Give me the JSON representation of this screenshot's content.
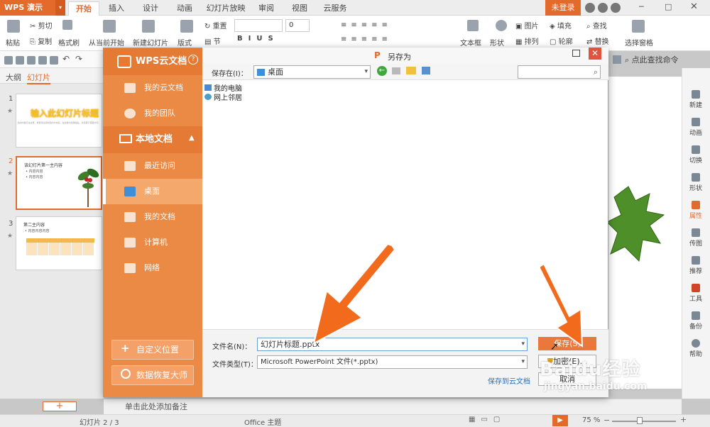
{
  "titlebar": {
    "app_name": "WPS 演示",
    "tabs": [
      "开始",
      "插入",
      "设计",
      "动画",
      "幻灯片放映",
      "审阅",
      "视图",
      "云服务"
    ],
    "active_tab": "开始",
    "login": "未登录"
  },
  "ribbon": {
    "clipboard": {
      "paste": "粘贴",
      "cut": "剪切",
      "copy": "复制",
      "format_painter": "格式刷"
    },
    "from_current": "从当前开始",
    "new_slide": "新建幻灯片",
    "layout": "版式",
    "section": "节",
    "reset": "重置",
    "font_size": "0",
    "textbox": "文本框",
    "shape": "形状",
    "picture": "图片",
    "fill": "填充",
    "arrange": "排列",
    "outline": "轮廓",
    "find": "查找",
    "replace": "替换",
    "select_pane": "选择窗格",
    "find_command": "点此查找命令"
  },
  "left_panel": {
    "tab_outline": "大纲",
    "tab_slides": "幻灯片",
    "slides": [
      {
        "num": "1",
        "title": "输入此幻灯片标题",
        "subtitle": "您的内容打在这里，或者通过复制您的文本后，在此框中选择粘贴，并选择只保留文字。"
      },
      {
        "num": "2",
        "title": "该幻灯片第一主内容",
        "bullets": [
          "内容内容",
          "内容内容"
        ]
      },
      {
        "num": "3",
        "title": "第二主内容",
        "bullets": [
          "内容内容内容"
        ]
      }
    ]
  },
  "dialog": {
    "title": "另存为",
    "close": "✕",
    "cloud_header": "WPS云文档",
    "help": "?",
    "cloud_items": [
      "我的云文档",
      "我的团队"
    ],
    "local_header": "本地文档",
    "local_items": [
      "最近访问",
      "桌面",
      "我的文档",
      "计算机",
      "网络"
    ],
    "active_item": "桌面",
    "custom_location": "自定义位置",
    "data_recovery": "数据恢复大师",
    "save_in_label": "保存在(I)：",
    "save_in_value": "桌面",
    "files": [
      "我的电脑",
      "网上邻居"
    ],
    "filename_label": "文件名(N)：",
    "filename_value": "幻灯片标题.pptx",
    "filetype_label": "文件类型(T)：",
    "filetype_value": "Microsoft PowerPoint 文件(*.pptx)",
    "save_to_cloud": "保存到云文档",
    "save_button": "保存(S)",
    "encrypt_button": "加密(E)...",
    "cancel_button": "取消"
  },
  "right_sidebar": [
    "新建",
    "动画",
    "切换",
    "形状",
    "属性",
    "传图",
    "推荐",
    "工具",
    "备份",
    "帮助"
  ],
  "notes_placeholder": "单击此处添加备注",
  "status": {
    "slide_indicator": "幻灯片 2 / 3",
    "theme": "Office 主题",
    "zoom": "75 %"
  },
  "watermark": {
    "brand": "Baidu经验",
    "url": "jingyan.baidu.com"
  },
  "colors": {
    "accent": "#e46a2b",
    "dialog_sidebar": "#ea8a45",
    "arrow": "#f26a1b"
  }
}
